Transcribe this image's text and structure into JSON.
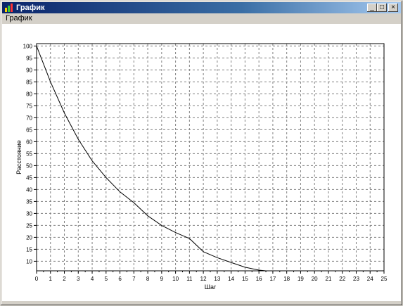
{
  "window": {
    "title": "График",
    "menu": [
      "График"
    ],
    "controls": {
      "minimize": "_",
      "maximize": "□",
      "close": "×"
    }
  },
  "colors": {
    "titlebar_start": "#0a246a",
    "titlebar_end": "#a6caf0",
    "grid": "#808080",
    "line": "#000000"
  },
  "chart_data": {
    "type": "line",
    "xlabel": "Шаг",
    "ylabel": "Расстояние",
    "xlim": [
      0,
      25
    ],
    "ylim": [
      6,
      101
    ],
    "xticks": [
      0,
      1,
      2,
      3,
      4,
      5,
      6,
      7,
      8,
      9,
      10,
      11,
      12,
      13,
      14,
      15,
      16,
      17,
      18,
      19,
      20,
      21,
      22,
      23,
      24,
      25
    ],
    "yticks": [
      10,
      15,
      20,
      25,
      30,
      35,
      40,
      45,
      50,
      55,
      60,
      65,
      70,
      75,
      80,
      85,
      90,
      95,
      100
    ],
    "grid": true,
    "series": [
      {
        "x": [
          0,
          1,
          2,
          3,
          4,
          5,
          6,
          7,
          8,
          9,
          10,
          11,
          12,
          13,
          14,
          15,
          16,
          16.5
        ],
        "y": [
          100,
          85,
          72,
          61,
          52,
          45,
          39,
          34.5,
          29,
          25,
          22,
          19.5,
          14,
          11.5,
          9.5,
          7.5,
          6.3,
          6
        ]
      }
    ]
  }
}
